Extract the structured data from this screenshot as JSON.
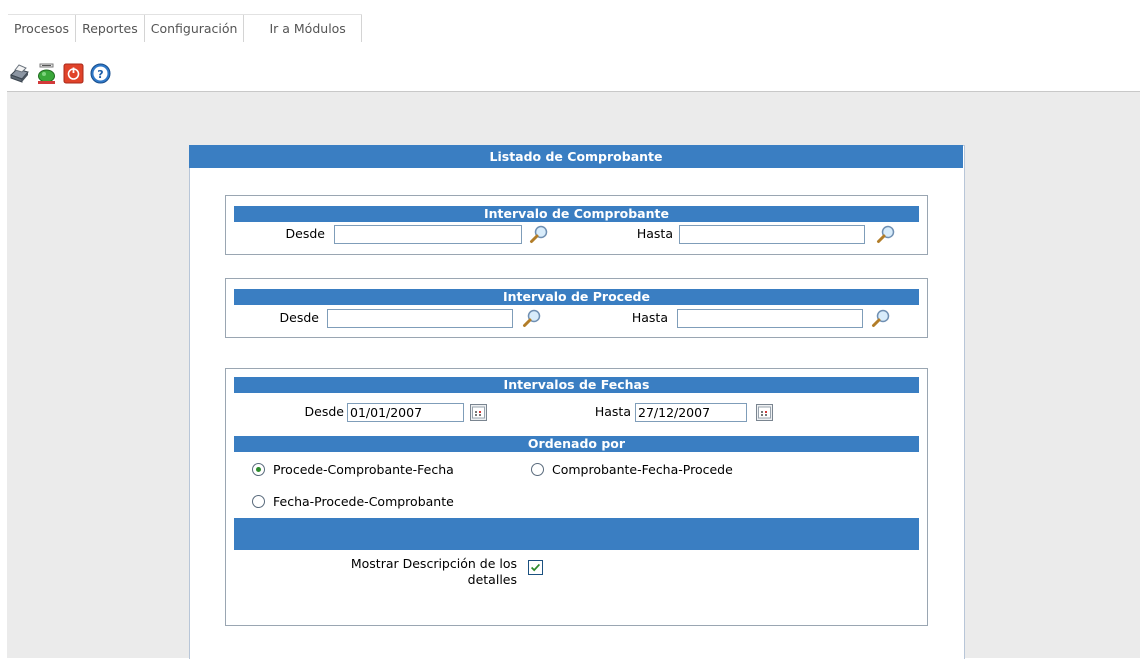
{
  "menu": {
    "items": [
      "Procesos",
      "Reportes",
      "Configuración"
    ],
    "modules": "Ir a Módulos"
  },
  "toolbar": {
    "icons": [
      "print-icon",
      "preview-icon",
      "exit-icon",
      "help-icon"
    ]
  },
  "panel": {
    "title": "Listado de Comprobante"
  },
  "comprobante": {
    "header": "Intervalo de Comprobante",
    "desde_label": "Desde",
    "hasta_label": "Hasta",
    "desde_value": "",
    "hasta_value": ""
  },
  "procede": {
    "header": "Intervalo de Procede",
    "desde_label": "Desde",
    "hasta_label": "Hasta",
    "desde_value": "",
    "hasta_value": ""
  },
  "fechas": {
    "header": "Intervalos de Fechas",
    "desde_label": "Desde",
    "hasta_label": "Hasta",
    "desde_value": "01/01/2007",
    "hasta_value": "27/12/2007"
  },
  "orden": {
    "header": "Ordenado por",
    "options": [
      "Procede-Comprobante-Fecha",
      "Comprobante-Fecha-Procede",
      "Fecha-Procede-Comprobante"
    ],
    "selected": "Procede-Comprobante-Fecha"
  },
  "detalles": {
    "label_line1": "Mostrar Descripción de los",
    "label_line2": "detalles",
    "checked": true
  },
  "colors": {
    "header_blue": "#3a7ec2",
    "background": "#ebebeb"
  }
}
